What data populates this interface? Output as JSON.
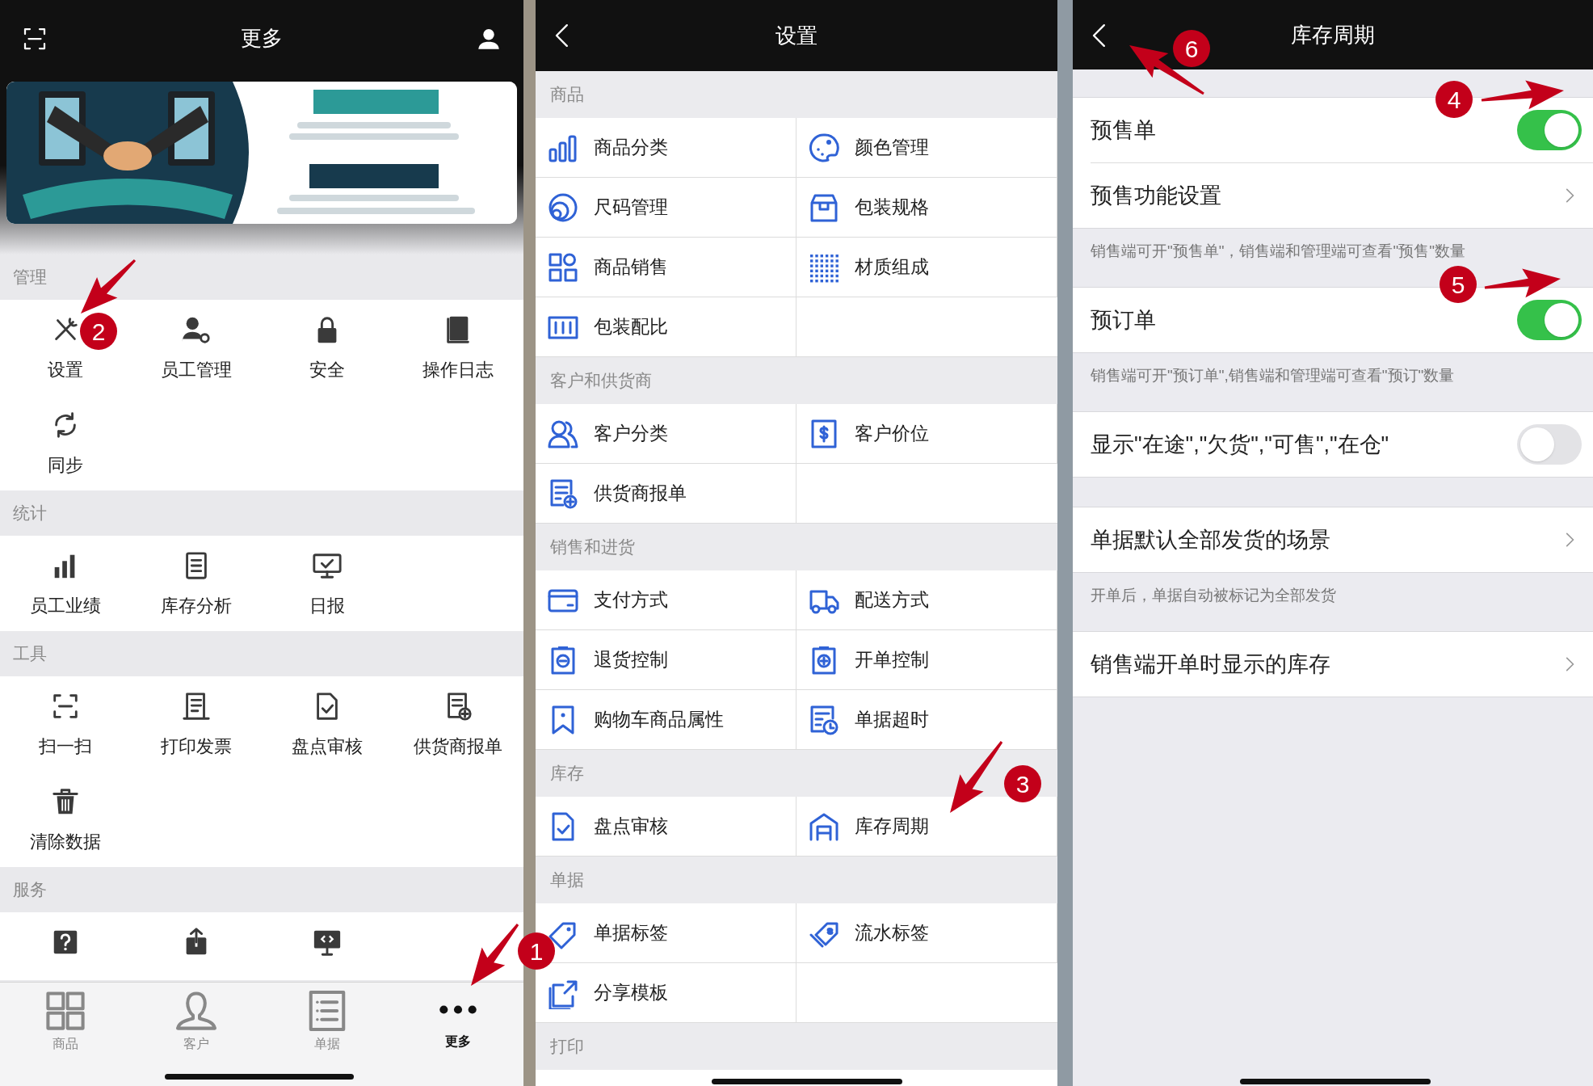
{
  "more_screen": {
    "title": "更多",
    "sections": [
      {
        "title": "管理",
        "items": [
          {
            "kind": "labeled",
            "label": "设置"
          },
          {
            "kind": "labeled",
            "label": "员工管理"
          },
          {
            "kind": "labeled",
            "label": "安全"
          },
          {
            "kind": "labeled",
            "label": "操作日志"
          },
          {
            "kind": "labeled",
            "label": "同步"
          }
        ]
      },
      {
        "title": "统计",
        "items": [
          {
            "kind": "labeled",
            "label": "员工业绩"
          },
          {
            "kind": "labeled",
            "label": "库存分析"
          },
          {
            "kind": "labeled",
            "label": "日报"
          }
        ]
      },
      {
        "title": "工具",
        "items": [
          {
            "kind": "labeled",
            "label": "扫一扫"
          },
          {
            "kind": "labeled",
            "label": "打印发票"
          },
          {
            "kind": "labeled",
            "label": "盘点审核"
          },
          {
            "kind": "labeled",
            "label": "供货商报单"
          },
          {
            "kind": "labeled",
            "label": "清除数据"
          }
        ]
      },
      {
        "title": "服务",
        "items": [
          {
            "kind": "icon"
          },
          {
            "kind": "icon"
          },
          {
            "kind": "icon"
          }
        ]
      }
    ],
    "tabs": [
      {
        "label": "商品",
        "selected": false
      },
      {
        "label": "客户",
        "selected": false
      },
      {
        "label": "单据",
        "selected": false
      },
      {
        "label": "更多",
        "selected": true
      }
    ]
  },
  "settings_screen": {
    "title": "设置",
    "sections": [
      {
        "title": "商品",
        "items": [
          {
            "label": "商品分类"
          },
          {
            "label": "颜色管理"
          },
          {
            "label": "尺码管理"
          },
          {
            "label": "包装规格"
          },
          {
            "label": "商品销售"
          },
          {
            "label": "材质组成"
          },
          {
            "label": "包装配比"
          }
        ]
      },
      {
        "title": "客户和供货商",
        "items": [
          {
            "label": "客户分类"
          },
          {
            "label": "客户价位"
          },
          {
            "label": "供货商报单"
          }
        ]
      },
      {
        "title": "销售和进货",
        "items": [
          {
            "label": "支付方式"
          },
          {
            "label": "配送方式"
          },
          {
            "label": "退货控制"
          },
          {
            "label": "开单控制"
          },
          {
            "label": "购物车商品属性"
          },
          {
            "label": "单据超时"
          }
        ]
      },
      {
        "title": "库存",
        "items": [
          {
            "label": "盘点审核"
          },
          {
            "label": "库存周期"
          }
        ]
      },
      {
        "title": "单据",
        "items": [
          {
            "label": "单据标签"
          },
          {
            "label": "流水标签"
          },
          {
            "label": "分享模板"
          }
        ]
      },
      {
        "title": "打印"
      }
    ]
  },
  "inventory_cycle_screen": {
    "title": "库存周期",
    "groups": [
      {
        "items": [
          {
            "kind": "toggle",
            "label": "预售单",
            "on": true
          },
          {
            "kind": "link",
            "label": "预售功能设置"
          }
        ],
        "note": "销售端可开\"预售单\"，销售端和管理端可查看\"预售\"数量"
      },
      {
        "items": [
          {
            "kind": "toggle",
            "label": "预订单",
            "on": true
          }
        ],
        "note": "销售端可开\"预订单\",销售端和管理端可查看\"预订\"数量"
      },
      {
        "items": [
          {
            "kind": "toggle",
            "label": "显示\"在途\",\"欠货\",\"可售\",\"在仓\"",
            "on": false
          }
        ]
      },
      {
        "items": [
          {
            "kind": "link",
            "label": "单据默认全部发货的场景"
          }
        ],
        "note": "开单后，单据自动被标记为全部发货"
      },
      {
        "items": [
          {
            "kind": "link",
            "label": "销售端开单时显示的库存"
          }
        ]
      }
    ]
  },
  "annotations": [
    {
      "number": "1"
    },
    {
      "number": "2"
    },
    {
      "number": "3"
    },
    {
      "number": "4"
    },
    {
      "number": "5"
    },
    {
      "number": "6"
    }
  ]
}
